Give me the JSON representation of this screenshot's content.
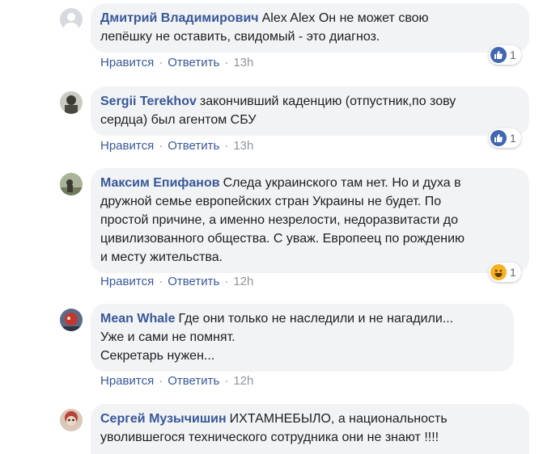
{
  "actions": {
    "like_label": "Нравится",
    "reply_label": "Ответить",
    "separator": "·"
  },
  "comments": [
    {
      "author": "Дмитрий Владимирович",
      "text_lines": [
        "Alex Alex Он не может свою",
        "лепёшку не оставить, свидомый - это диагноз."
      ],
      "time": "13h",
      "reaction": {
        "icon": "like-icon",
        "count": "1"
      }
    },
    {
      "author": "Sergii Terekhov",
      "text_lines": [
        "закончивший каденцию (отпустник,по зову",
        "сердца) был агентом СБУ"
      ],
      "time": "13h",
      "reaction": {
        "icon": "like-icon",
        "count": "1"
      }
    },
    {
      "author": "Максим Епифанов",
      "text_lines": [
        "Следа украинского там нет. Но и духа в",
        "дружной семье европейских стран Украины не будет. По",
        "простой причине, а именно незрелости, недоразвитасти до",
        "цивилизованного общества. С уваж. Европеец по рождению",
        "и месту жительства."
      ],
      "time": "12h",
      "reaction": {
        "icon": "haha-icon",
        "count": "1"
      }
    },
    {
      "author": "Mean Whale",
      "text_lines": [
        "Где они только не наследили и не нагадили...",
        "Уже и сами не помнят.",
        "Секретарь нужен..."
      ],
      "time": "12h"
    },
    {
      "author": "Сергей Музычишин",
      "text_lines": [
        "ИХТАМНЕБЫЛО, а национальность",
        "уволившегося технического сотрудника они не знают !!!!"
      ]
    }
  ],
  "colors": {
    "author": "#385898",
    "bubble": "#f2f3f5",
    "like": "#4267b2",
    "haha": "#f7b125"
  }
}
